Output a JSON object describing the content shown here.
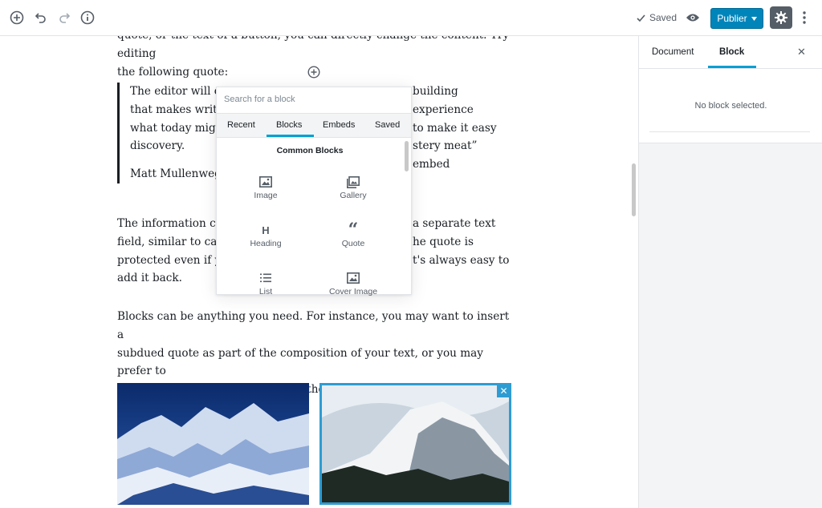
{
  "toolbar": {
    "saved_label": "Saved",
    "publish_label": "Publier"
  },
  "content": {
    "intro_line1": "quote, or the text of a button, you can directly change the content. Try editing",
    "intro_line2": "the following quote:",
    "quote_lines": [
      "The editor will en",
      "that makes writin",
      "what today might",
      "discovery."
    ],
    "quote_right_lines": [
      "building experience",
      "to make it easy",
      "stery meat” embed"
    ],
    "quote_cite": "Matt Mullenweg,",
    "info_left": [
      "The information cor",
      "field, similar to capt",
      "protected even if yo",
      "add it back."
    ],
    "info_right": [
      "a separate text",
      "he quote is",
      "t's always easy to"
    ],
    "para2_line1": "Blocks can be anything you need. For instance, you may want to insert a",
    "para2_line2": "subdued quote as part of the composition of your text, or you may prefer to",
    "para2_line3": "display a giant stylized one. All of these options are available in the inserter."
  },
  "inserter": {
    "search_placeholder": "Search for a block",
    "tabs": [
      "Recent",
      "Blocks",
      "Embeds",
      "Saved"
    ],
    "active_tab": "Blocks",
    "heading": "Common Blocks",
    "items": [
      {
        "label": "Image",
        "icon": "image-icon"
      },
      {
        "label": "Gallery",
        "icon": "gallery-icon"
      },
      {
        "label": "Heading",
        "icon": "heading-icon"
      },
      {
        "label": "Quote",
        "icon": "quote-icon"
      },
      {
        "label": "List",
        "icon": "list-icon"
      },
      {
        "label": "Cover Image",
        "icon": "cover-image-icon"
      }
    ],
    "heading_glyph": "H",
    "quote_glyph": "“"
  },
  "sidebar": {
    "tabs": [
      "Document",
      "Block"
    ],
    "active_tab": "Block",
    "empty_message": "No block selected."
  },
  "colors": {
    "accent": "#00a0d2",
    "publish": "#0085ba",
    "selection": "#2e9cd2"
  }
}
